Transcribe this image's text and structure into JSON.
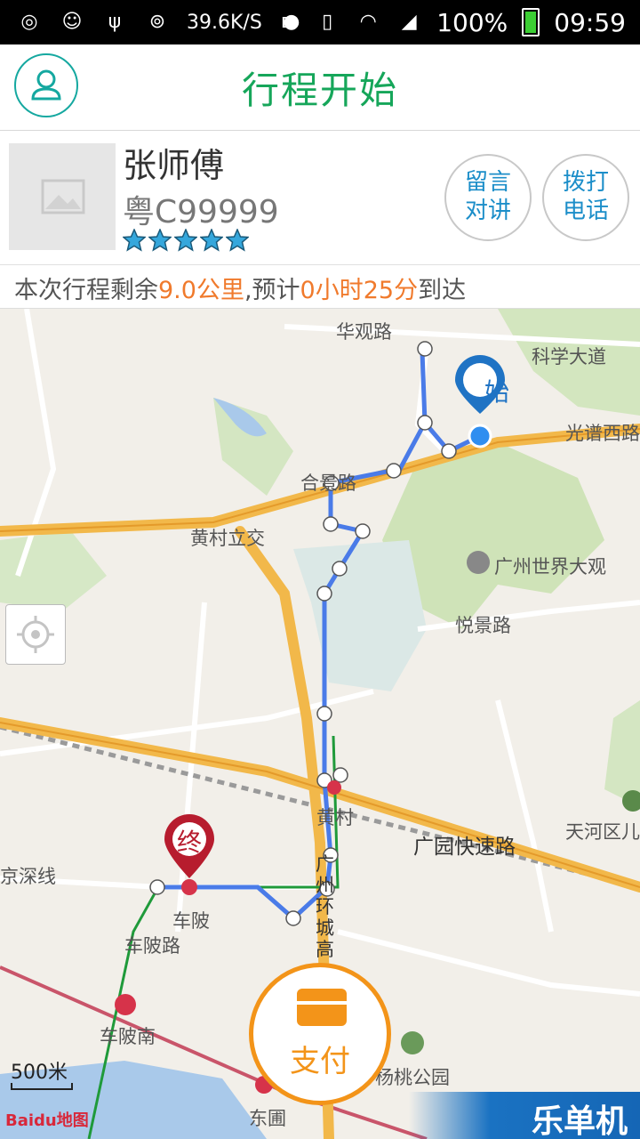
{
  "status_bar": {
    "speed": "39.6K/S",
    "battery": "100%",
    "time": "09:59"
  },
  "header": {
    "title": "行程开始"
  },
  "driver": {
    "name": "张师傅",
    "plate": "粤C99999",
    "rating_stars": 5,
    "message_button": [
      "留言",
      "对讲"
    ],
    "call_button": [
      "拨打",
      "电话"
    ]
  },
  "trip_info": {
    "prefix": "本次行程剩余",
    "distance": "9.0公里",
    "middle": ",预计",
    "eta": "0小时25分",
    "suffix": "到达"
  },
  "map": {
    "labels": {
      "huaguan_road": "华观路",
      "kexue_avenue": "科学大道",
      "guangpu_west": "光谱西路",
      "hefang_road": "合景路",
      "huangcun_interchange": "黄村立交",
      "world_park": "广州世界大观",
      "yuejing_road": "悦景路",
      "huangcun": "黄村",
      "guangyuan_expressway": "广园快速路",
      "tianhe": "天河区儿",
      "jingshen_line": "京深线",
      "chebei": "车陂",
      "chebei_road": "车陂路",
      "huanchenggao": "广州环城高",
      "chebei_south": "车陂南",
      "yangtao_park": "杨桃公园",
      "dongpu": "东圃"
    },
    "start_marker": "始",
    "end_marker": "终",
    "scale": "500米",
    "baidu_logo": "Baidu地图"
  },
  "pay_button": {
    "label": "支付"
  },
  "watermark": "乐单机",
  "colors": {
    "title_green": "#16a65a",
    "accent_blue": "#1c8ec9",
    "highlight_orange": "#f07a2c",
    "pay_orange": "#f39419",
    "route_blue": "#4a7be8"
  }
}
